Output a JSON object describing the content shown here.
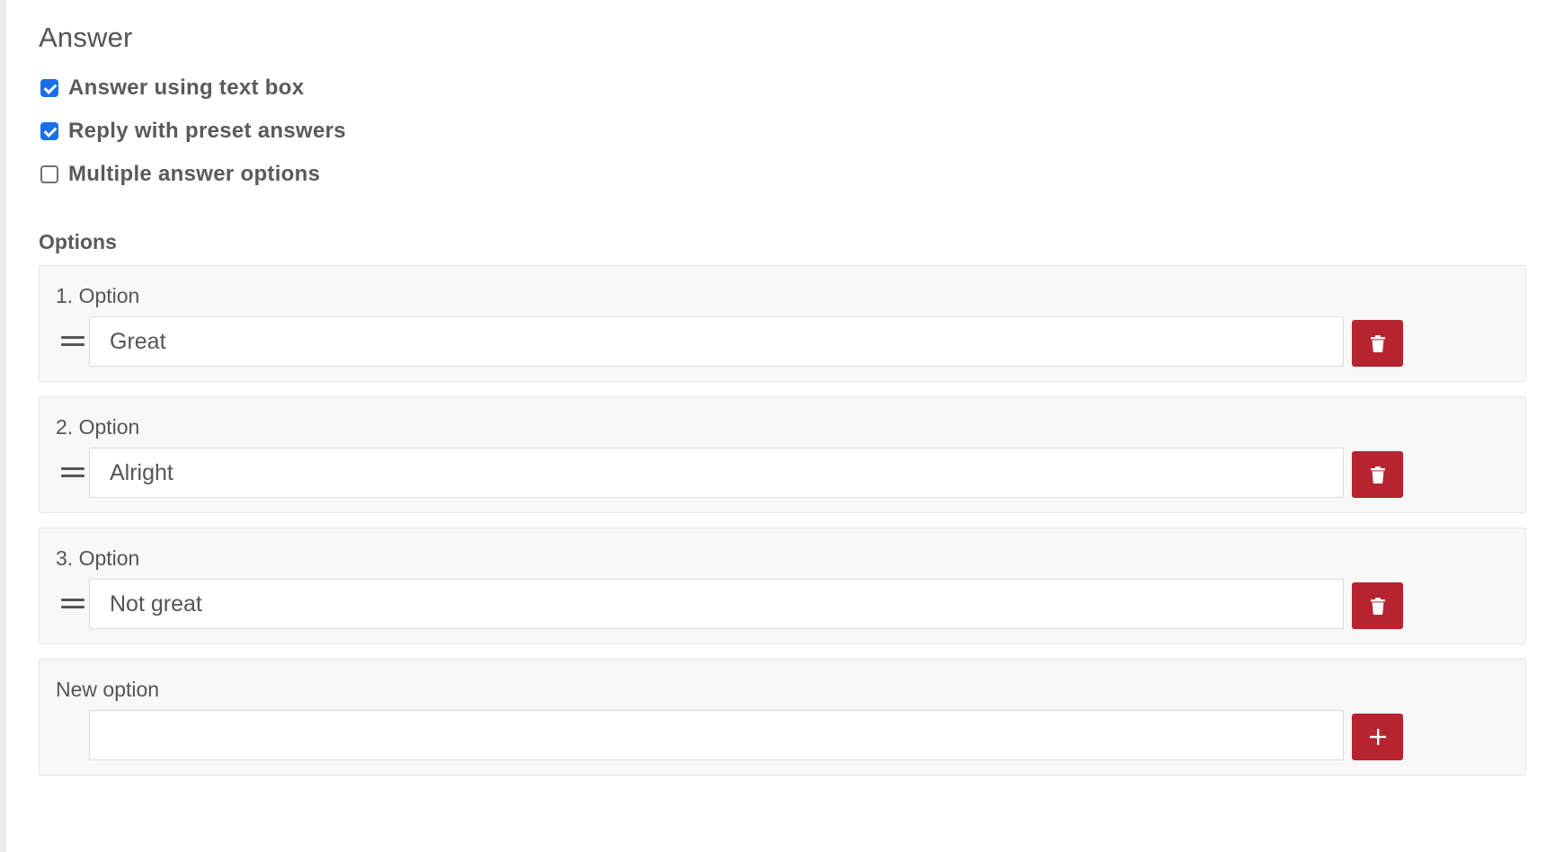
{
  "answer": {
    "title": "Answer",
    "checkboxes": [
      {
        "label": "Answer using text box",
        "checked": true
      },
      {
        "label": "Reply with preset answers",
        "checked": true
      },
      {
        "label": "Multiple answer options",
        "checked": false
      }
    ]
  },
  "options": {
    "heading": "Options",
    "items": [
      {
        "label": "1. Option",
        "value": "Great"
      },
      {
        "label": "2. Option",
        "value": "Alright"
      },
      {
        "label": "3. Option",
        "value": "Not great"
      }
    ],
    "new_option": {
      "label": "New option",
      "value": ""
    }
  },
  "icons": {
    "delete": "trash-icon",
    "add": "plus-icon",
    "drag": "drag-handle-icon"
  },
  "colors": {
    "checkbox_accent": "#1a6fe8",
    "danger_button": "#b5242f"
  }
}
